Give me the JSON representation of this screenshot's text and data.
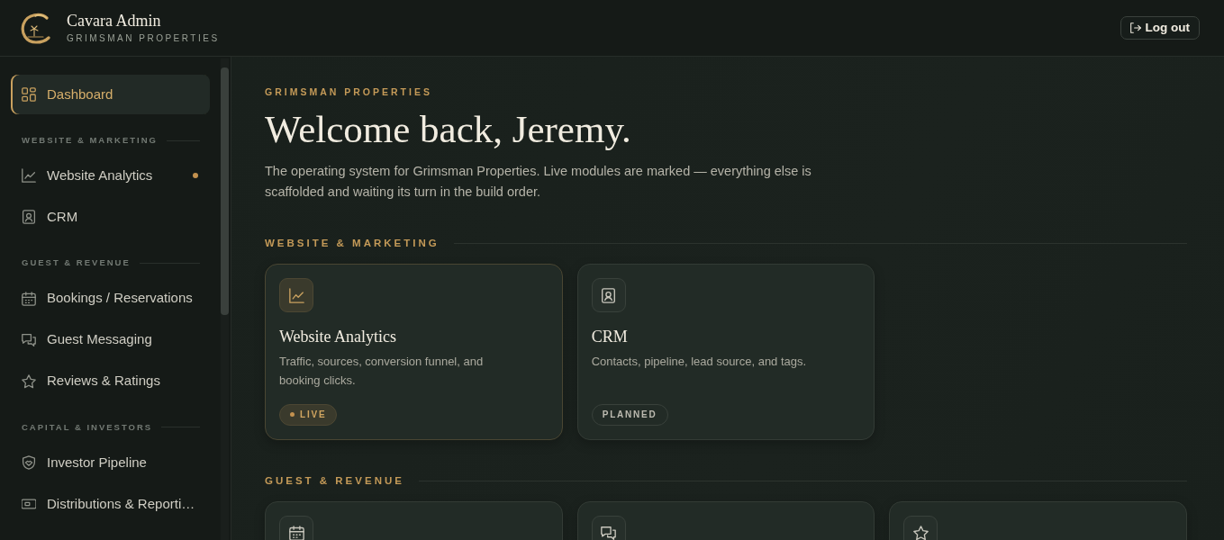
{
  "header": {
    "title": "Cavara Admin",
    "subtitle": "GRIMSMAN PROPERTIES",
    "logout_button": "Log out"
  },
  "sidebar": {
    "sections": [
      {
        "items": [
          {
            "label": "Dashboard",
            "selected": true,
            "live": false
          }
        ]
      },
      {
        "title": "WEBSITE & MARKETING",
        "items": [
          {
            "label": "Website Analytics",
            "selected": false,
            "live": true
          },
          {
            "label": "CRM",
            "selected": false,
            "live": false
          }
        ]
      },
      {
        "title": "GUEST & REVENUE",
        "items": [
          {
            "label": "Bookings / Reservations",
            "selected": false,
            "live": false
          },
          {
            "label": "Guest Messaging",
            "selected": false,
            "live": false
          },
          {
            "label": "Reviews & Ratings",
            "selected": false,
            "live": false
          }
        ]
      },
      {
        "title": "CAPITAL & INVESTORS",
        "items": [
          {
            "label": "Investor Pipeline",
            "selected": false,
            "live": false
          },
          {
            "label": "Distributions & Reporti…",
            "selected": false,
            "live": false
          }
        ]
      }
    ]
  },
  "main": {
    "eyebrow": "GRIMSMAN PROPERTIES",
    "heading": "Welcome back, Jeremy.",
    "intro": "The operating system for Grimsman Properties. Live modules are marked — everything else is scaffolded and waiting its turn in the build order.",
    "sections": [
      {
        "title": "WEBSITE & MARKETING",
        "cards": [
          {
            "live": true,
            "title": "Website Analytics",
            "description": "Traffic, sources, conversion funnel, and booking clicks.",
            "badge": "LIVE"
          },
          {
            "live": false,
            "title": "CRM",
            "description": "Contacts, pipeline, lead source, and tags.",
            "badge": "PLANNED"
          }
        ]
      },
      {
        "title": "GUEST & REVENUE",
        "cards": [
          {
            "live": false
          },
          {
            "live": false
          },
          {
            "live": false
          }
        ]
      }
    ]
  }
}
